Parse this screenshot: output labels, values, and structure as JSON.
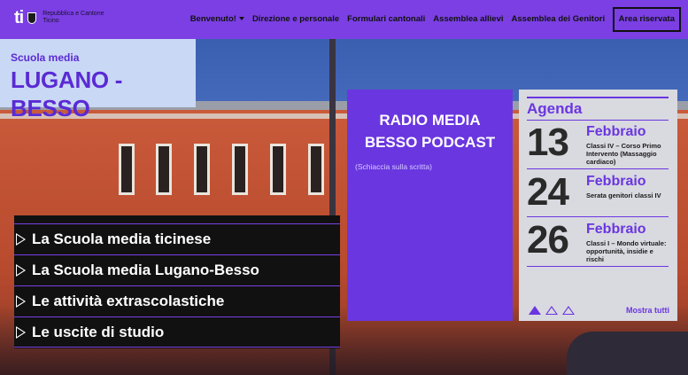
{
  "header": {
    "logo_mark": "ti",
    "logo_text_line1": "Repubblica e Cantone",
    "logo_text_line2": "Ticino",
    "nav": [
      {
        "label": "Benvenuto!"
      },
      {
        "label": "Direzione e personale"
      },
      {
        "label": "Formulari cantonali"
      },
      {
        "label": "Assemblea allievi"
      },
      {
        "label": "Assemblea dei Genitori"
      },
      {
        "label": "Area riservata"
      }
    ]
  },
  "school": {
    "subtitle": "Scuola media",
    "name": "LUGANO -BESSO"
  },
  "menu": [
    {
      "label": "La Scuola media ticinese"
    },
    {
      "label": "La Scuola media Lugano-Besso"
    },
    {
      "label": "Le attività extrascolastiche"
    },
    {
      "label": "Le uscite di studio"
    }
  ],
  "podcast": {
    "title_line1": "RADIO MEDIA",
    "title_line2": "BESSO PODCAST",
    "hint": "(Schiaccia sulla scritta)"
  },
  "agenda": {
    "title": "Agenda",
    "events": [
      {
        "day": "13",
        "month": "Febbraio",
        "desc": "Classi IV – Corso Primo Intervento (Massaggio cardiaco)"
      },
      {
        "day": "24",
        "month": "Febbraio",
        "desc": "Serata genitori classi IV"
      },
      {
        "day": "26",
        "month": "Febbraio",
        "desc": "Classi I – Mondo virtuale: opportunità, insidie e rischi"
      }
    ],
    "more_label": "Mostra tutti"
  },
  "colors": {
    "accent": "#7b3fe4",
    "podcast_bg": "#6a36e0",
    "agenda_bg": "#d9d9e0",
    "title_box_bg": "#c9d8f5"
  },
  "icons": {
    "menu_arrow": "triangle-right-outline-icon",
    "pager_active": "triangle-up-filled-icon",
    "pager_inactive": "triangle-up-outline-icon"
  }
}
